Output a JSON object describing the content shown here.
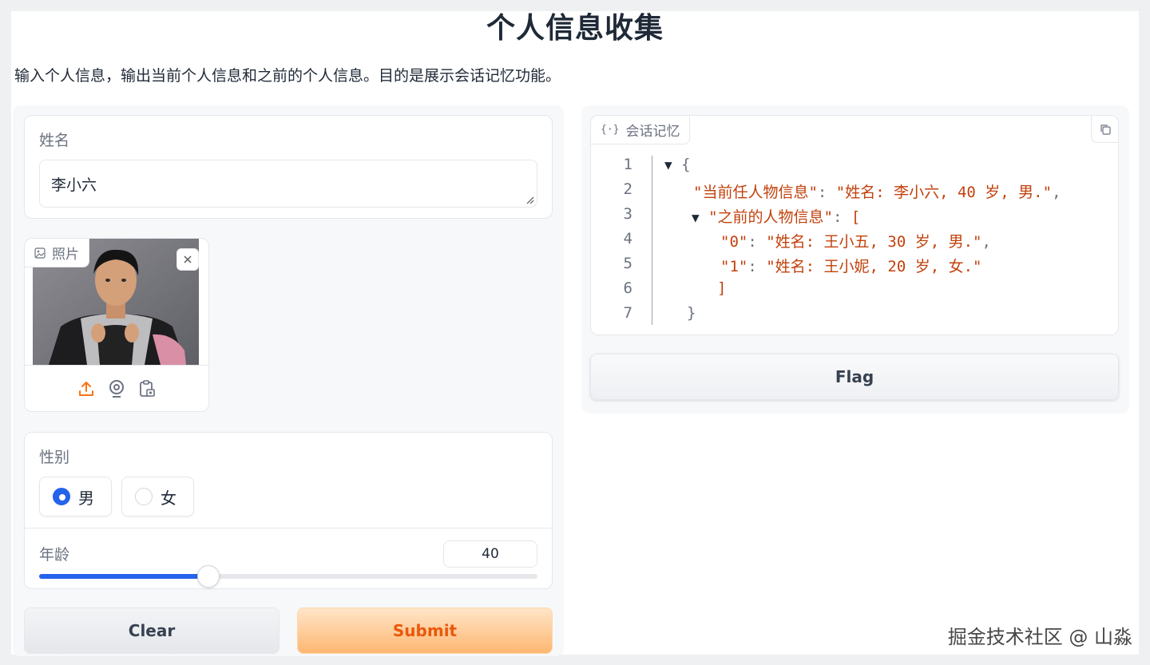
{
  "page": {
    "title": "个人信息收集",
    "description": "输入个人信息，输出当前个人信息和之前的个人信息。目的是展示会话记忆功能。"
  },
  "name_field": {
    "label": "姓名",
    "value": "李小六"
  },
  "photo_field": {
    "label": "照片",
    "icons": [
      "upload-icon",
      "webcam-icon",
      "clipboard-icon"
    ]
  },
  "gender_field": {
    "label": "性别",
    "options": [
      "男",
      "女"
    ],
    "selected": "男"
  },
  "age_field": {
    "label": "年龄",
    "value": "40",
    "slider_fraction": 0.34
  },
  "buttons": {
    "clear": "Clear",
    "submit": "Submit",
    "flag": "Flag"
  },
  "json_output": {
    "label": "会话记忆",
    "line_numbers": [
      "1",
      "2",
      "3",
      "4",
      "5",
      "6",
      "7"
    ],
    "key_current": "\"当前任人物信息\"",
    "val_current": "\"姓名: 李小六, 40 岁, 男.\"",
    "key_prev": "\"之前的人物信息\"",
    "idx0": "\"0\"",
    "val0": "\"姓名: 王小五, 30 岁, 男.\"",
    "idx1": "\"1\"",
    "val1": "\"姓名: 王小妮, 20 岁, 女.\""
  },
  "watermark": "掘金技术社区 @ 山淼",
  "colors": {
    "accent": "#2563eb",
    "submit_text": "#ea580c",
    "json_string": "#c2410c"
  }
}
